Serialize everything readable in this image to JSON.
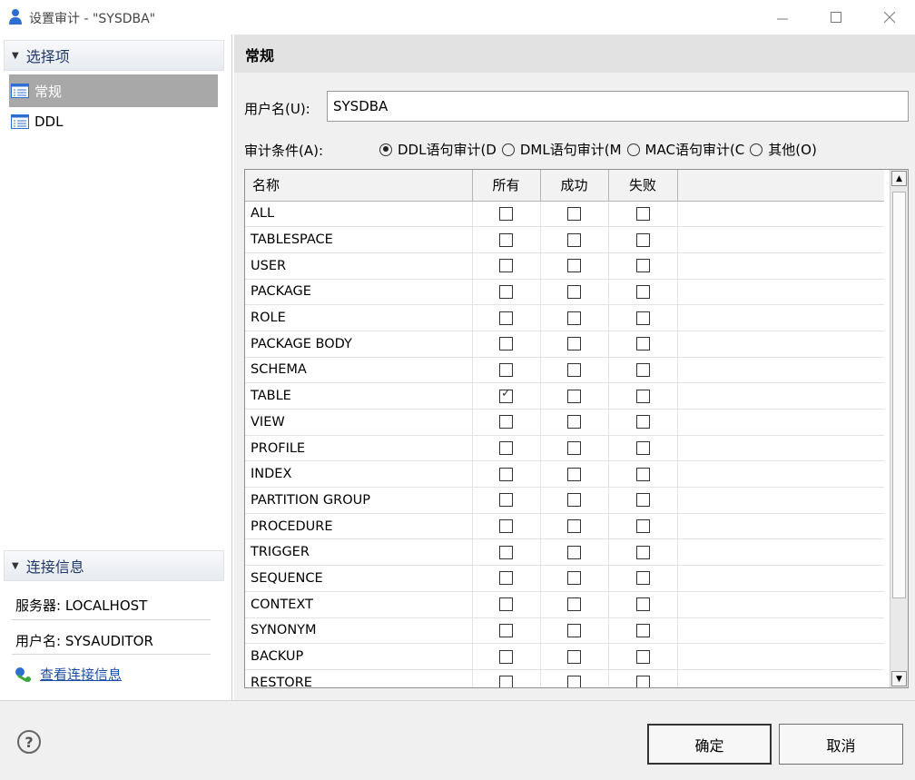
{
  "window": {
    "title": "设置审计 - \"SYSDBA\""
  },
  "left": {
    "options_header": "选择项",
    "nav_items": [
      {
        "label": "常规"
      },
      {
        "label": "DDL"
      }
    ],
    "conn_header": "连接信息",
    "server": "服务器: LOCALHOST",
    "user": "用户名: SYSAUDITOR",
    "view_link": "查看连接信息"
  },
  "main": {
    "header": "常规",
    "username_label": "用户名(U):",
    "username_value": "SYSDBA",
    "condition_label": "审计条件(A):",
    "radios": [
      {
        "label": "DDL语句审计(D",
        "selected": true
      },
      {
        "label": "DML语句审计(M",
        "selected": false
      },
      {
        "label": "MAC语句审计(C",
        "selected": false
      },
      {
        "label": "其他(O)",
        "selected": false
      }
    ],
    "table": {
      "columns": [
        "名称",
        "所有",
        "成功",
        "失败"
      ],
      "rows": [
        {
          "name": "ALL",
          "all": false,
          "success": false,
          "fail": false
        },
        {
          "name": "TABLESPACE",
          "all": false,
          "success": false,
          "fail": false
        },
        {
          "name": "USER",
          "all": false,
          "success": false,
          "fail": false
        },
        {
          "name": "PACKAGE",
          "all": false,
          "success": false,
          "fail": false
        },
        {
          "name": "ROLE",
          "all": false,
          "success": false,
          "fail": false
        },
        {
          "name": "PACKAGE BODY",
          "all": false,
          "success": false,
          "fail": false
        },
        {
          "name": "SCHEMA",
          "all": false,
          "success": false,
          "fail": false
        },
        {
          "name": "TABLE",
          "all": true,
          "success": false,
          "fail": false
        },
        {
          "name": "VIEW",
          "all": false,
          "success": false,
          "fail": false
        },
        {
          "name": "PROFILE",
          "all": false,
          "success": false,
          "fail": false
        },
        {
          "name": "INDEX",
          "all": false,
          "success": false,
          "fail": false
        },
        {
          "name": "PARTITION GROUP",
          "all": false,
          "success": false,
          "fail": false
        },
        {
          "name": "PROCEDURE",
          "all": false,
          "success": false,
          "fail": false
        },
        {
          "name": "TRIGGER",
          "all": false,
          "success": false,
          "fail": false
        },
        {
          "name": "SEQUENCE",
          "all": false,
          "success": false,
          "fail": false
        },
        {
          "name": "CONTEXT",
          "all": false,
          "success": false,
          "fail": false
        },
        {
          "name": "SYNONYM",
          "all": false,
          "success": false,
          "fail": false
        },
        {
          "name": "BACKUP",
          "all": false,
          "success": false,
          "fail": false
        },
        {
          "name": "RESTORE",
          "all": false,
          "success": false,
          "fail": false
        }
      ]
    }
  },
  "buttons": {
    "ok": "确定",
    "cancel": "取消"
  },
  "colors": {
    "selected_nav": "#a8a8a8",
    "link": "#1a4ea8",
    "header_text": "#20386a"
  }
}
